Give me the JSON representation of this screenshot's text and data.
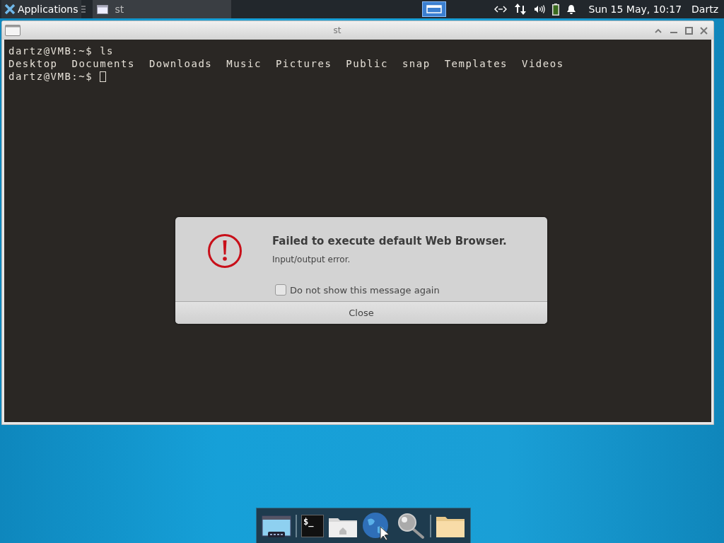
{
  "top_panel": {
    "app_menu": "Applications",
    "tasks": [
      {
        "label": "st",
        "selected": true
      }
    ],
    "workspaces": [
      {
        "selected": true
      }
    ],
    "clock": "Sun 15 May, 10:17",
    "user": "Dartz"
  },
  "window": {
    "title": "st",
    "lines": [
      {
        "kind": "prompt",
        "prompt": "dartz@VMB:~$",
        "command": "ls"
      },
      {
        "kind": "output",
        "items": [
          "Desktop",
          "Documents",
          "Downloads",
          "Music",
          "Pictures",
          "Public",
          "snap",
          "Templates",
          "Videos"
        ]
      },
      {
        "kind": "prompt",
        "prompt": "dartz@VMB:~$",
        "cursor": true
      }
    ]
  },
  "dialog": {
    "title": "Failed to execute default Web Browser.",
    "message": "Input/output error.",
    "checkbox": {
      "label": "Do not show this message again",
      "checked": false
    },
    "button": "Close"
  },
  "dock": {
    "terminal_glyph": "$_"
  }
}
